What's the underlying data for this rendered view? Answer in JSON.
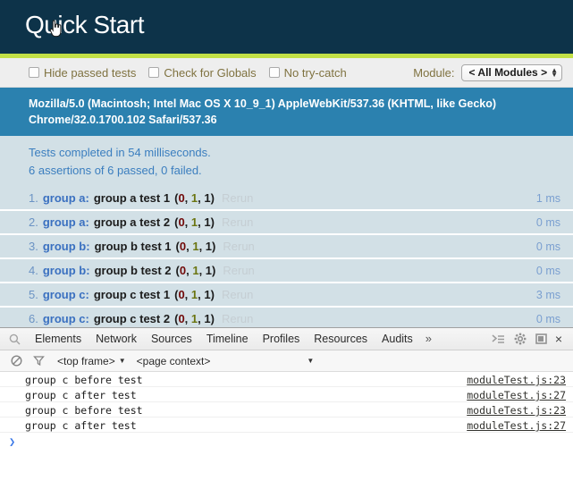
{
  "qunit": {
    "title": "Quick Start",
    "cursor_icon": "pointing-hand-cursor",
    "toolbar": {
      "checkboxes": [
        {
          "label": "Hide passed tests",
          "checked": false
        },
        {
          "label": "Check for Globals",
          "checked": false
        },
        {
          "label": "No try-catch",
          "checked": false
        }
      ],
      "module_label": "Module:",
      "module_value": "< All Modules >"
    },
    "useragent": "Mozilla/5.0 (Macintosh; Intel Mac OS X 10_9_1) AppleWebKit/537.36 (KHTML, like Gecko) Chrome/32.0.1700.102 Safari/537.36",
    "summary": {
      "line1": "Tests completed in 54 milliseconds.",
      "line2": "6 assertions of 6 passed, 0 failed."
    },
    "rerun_label": "Rerun",
    "tests": [
      {
        "num": "1.",
        "module": "group a:",
        "name": "group a test 1",
        "failed": "0",
        "passed": "1",
        "total": "1",
        "runtime": "1 ms"
      },
      {
        "num": "2.",
        "module": "group a:",
        "name": "group a test 2",
        "failed": "0",
        "passed": "1",
        "total": "1",
        "runtime": "0 ms"
      },
      {
        "num": "3.",
        "module": "group b:",
        "name": "group b test 1",
        "failed": "0",
        "passed": "1",
        "total": "1",
        "runtime": "0 ms"
      },
      {
        "num": "4.",
        "module": "group b:",
        "name": "group b test 2",
        "failed": "0",
        "passed": "1",
        "total": "1",
        "runtime": "0 ms"
      },
      {
        "num": "5.",
        "module": "group c:",
        "name": "group c test 1",
        "failed": "0",
        "passed": "1",
        "total": "1",
        "runtime": "3 ms"
      },
      {
        "num": "6.",
        "module": "group c:",
        "name": "group c test 2",
        "failed": "0",
        "passed": "1",
        "total": "1",
        "runtime": "0 ms"
      }
    ],
    "colors": {
      "header_bg": "#0d3349",
      "accent": "#c2e046",
      "banner_bg": "#2b81af",
      "row_bg": "#d2e0e6",
      "pass_green": "#6b7511",
      "fail_red": "#710909"
    }
  },
  "devtools": {
    "tabs": [
      "Elements",
      "Network",
      "Sources",
      "Timeline",
      "Profiles",
      "Resources",
      "Audits"
    ],
    "more_label": "»",
    "search_icon": "search-icon",
    "right_icons": [
      "console-drawer-icon",
      "gear-icon",
      "dock-position-icon"
    ],
    "close_label": "×",
    "filterbar": {
      "clear_icon": "clear-console-icon",
      "filter_icon": "filter-icon",
      "frame": "<top frame>",
      "context": "<page context>",
      "caret": "▼"
    },
    "console": {
      "messages": [
        {
          "text": "group c before test",
          "source": "moduleTest.js:23"
        },
        {
          "text": "group c after test",
          "source": "moduleTest.js:27"
        },
        {
          "text": "group c before test",
          "source": "moduleTest.js:23"
        },
        {
          "text": "group c after test",
          "source": "moduleTest.js:27"
        }
      ],
      "prompt": "❯"
    }
  }
}
